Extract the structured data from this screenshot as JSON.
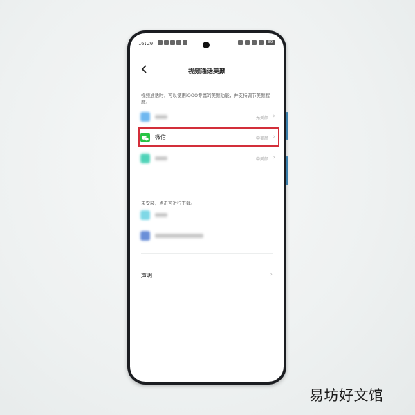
{
  "status_bar": {
    "time": "16:20",
    "battery": "89"
  },
  "header": {
    "title": "视频通话美颜"
  },
  "description": "视频通话时，可以使用iQOO专属的美颜功能，并支持调节美颜程度。",
  "installed_apps": [
    {
      "name": "",
      "value": "无美颜",
      "icon_color": "#6fb8f0",
      "blurred": true
    },
    {
      "name": "微信",
      "value": "中美颜",
      "icon_color": "#28c445",
      "blurred": false
    },
    {
      "name": "",
      "value": "中美颜",
      "icon_color": "#4fd3b8",
      "blurred": true
    }
  ],
  "not_installed_section": {
    "label": "未安装，点击可进行下载。"
  },
  "not_installed_apps": [
    {
      "icon_color": "#7fd8e6"
    },
    {
      "icon_color": "#6a8fd8"
    }
  ],
  "statement": {
    "label": "声明"
  },
  "watermark": "易坊好文馆",
  "colors": {
    "highlight": "#d32f3a",
    "wechat": "#28c445"
  }
}
